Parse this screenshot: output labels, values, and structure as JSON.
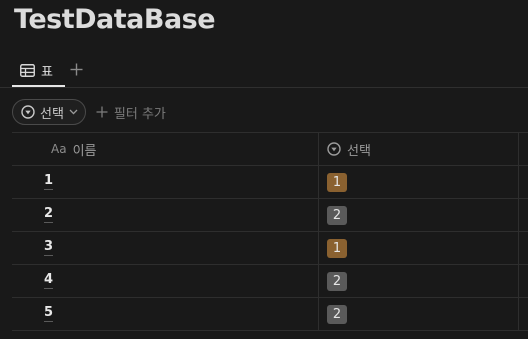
{
  "database_title": "TestDataBase",
  "tabs": [
    {
      "label": "표",
      "icon": "table-icon",
      "active": true
    }
  ],
  "tab_add_icon": "plus-icon",
  "filter": {
    "chip_label": "선택",
    "chip_icon": "select-property-icon",
    "chip_chevron": "chevron-down-icon",
    "add_label": "필터 추가",
    "add_icon": "plus-icon"
  },
  "table": {
    "columns": [
      {
        "label": "이름",
        "icon": "Aa"
      },
      {
        "label": "선택",
        "icon": "select-property-icon"
      }
    ],
    "rows": [
      {
        "name": "1",
        "select": "1"
      },
      {
        "name": "2",
        "select": "2"
      },
      {
        "name": "3",
        "select": "1"
      },
      {
        "name": "4",
        "select": "2"
      },
      {
        "name": "5",
        "select": "2"
      }
    ]
  },
  "tag_colors": {
    "1": "#8a6130",
    "2": "#5a5a5a"
  }
}
